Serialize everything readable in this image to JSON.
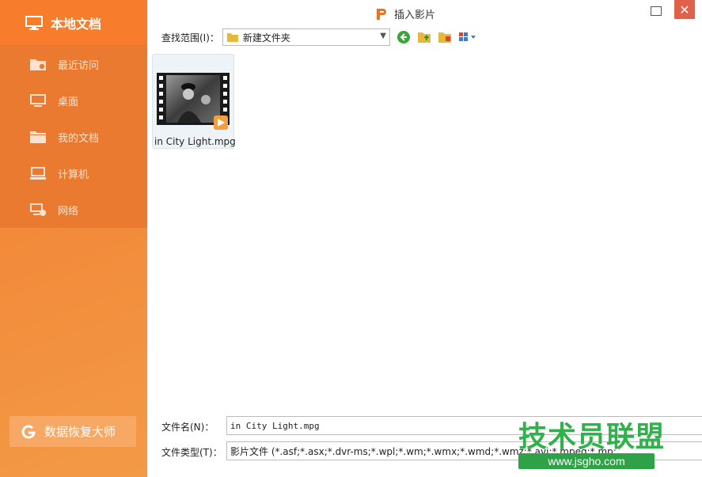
{
  "sidebar": {
    "header": "本地文档",
    "items": [
      {
        "label": "最近访问",
        "icon": "recent-folder-icon"
      },
      {
        "label": "桌面",
        "icon": "desktop-icon"
      },
      {
        "label": "我的文档",
        "icon": "documents-folder-icon"
      },
      {
        "label": "计算机",
        "icon": "computer-icon"
      },
      {
        "label": "网络",
        "icon": "network-icon"
      }
    ],
    "recover_button": "数据恢复大师"
  },
  "window": {
    "title": "插入影片",
    "close_glyph": "✕"
  },
  "toolbar": {
    "look_in_label": "查找范围(I)：",
    "location": "新建文件夹"
  },
  "files": [
    {
      "name": "in City Light.mpg",
      "type": "video-file"
    }
  ],
  "bottom": {
    "filename_label": "文件名(N)：",
    "filename_value": "in City Light.mpg",
    "filetype_label": "文件类型(T)：",
    "filetype_value": "影片文件 (*.asf;*.asx;*.dvr-ms;*.wpl;*.wm;*.wmx;*.wmd;*.wmz;*.avi;*.mpeg;*.mp;"
  },
  "watermark": {
    "text": "技术员联盟",
    "url": "www.jsgho.com"
  },
  "colors": {
    "sidebar_accent": "#f28a3a",
    "close_button": "#e0604a",
    "watermark_green": "#2fb24a"
  }
}
